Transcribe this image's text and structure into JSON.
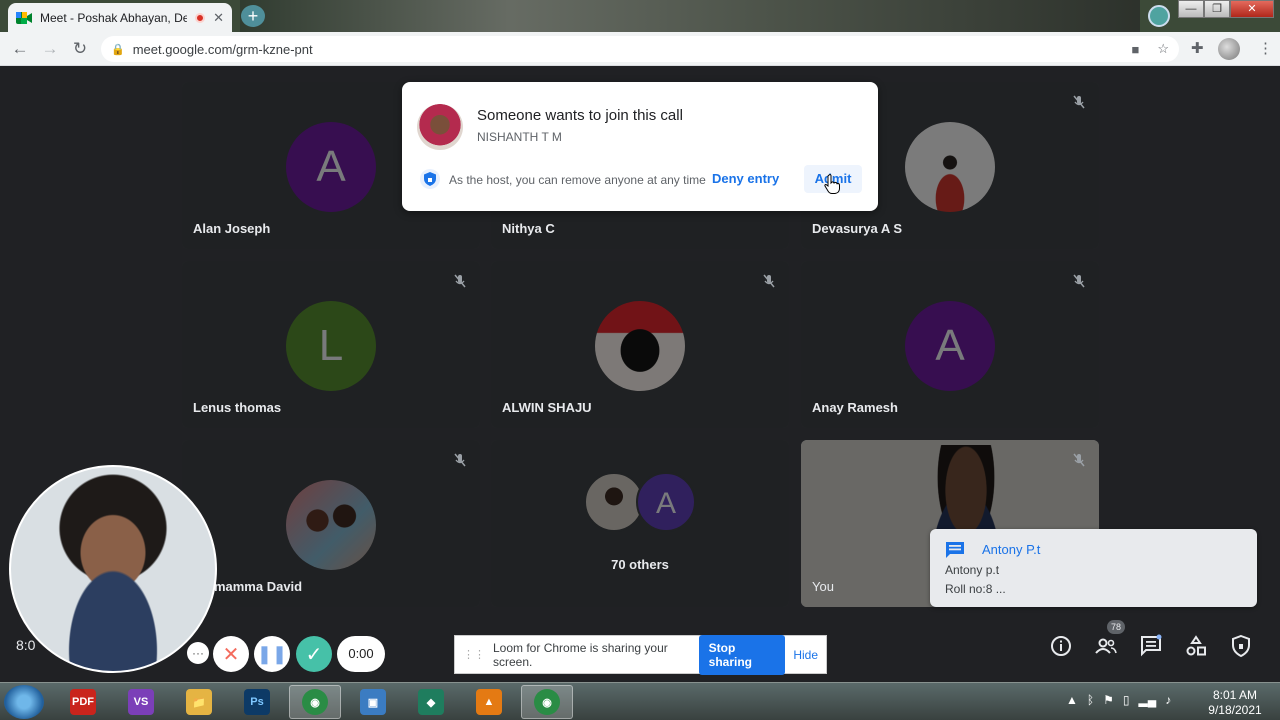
{
  "browser": {
    "tab_title": "Meet - Poshak Abhayan, De",
    "tab_close": "✕",
    "new_tab": "+",
    "url": "meet.google.com/grm-kzne-pnt",
    "window_controls": [
      "—",
      "❐",
      "✕"
    ]
  },
  "tiles": [
    {
      "name": "Alan Joseph",
      "avatar_letter": "A",
      "avatar_color": "#6a1b9a"
    },
    {
      "name": "Nithya C"
    },
    {
      "name": "Devasurya A S"
    },
    {
      "name": "Lenus thomas",
      "avatar_letter": "L",
      "avatar_color": "#558b2f"
    },
    {
      "name": "ALWIN SHAJU"
    },
    {
      "name": "Anay Ramesh",
      "avatar_letter": "A",
      "avatar_color": "#6a1b9a"
    },
    {
      "name": "Ammamma David"
    },
    {
      "others_label": "70 others",
      "avatar_letter": "A"
    },
    {
      "name": "You"
    }
  ],
  "join_request": {
    "title": "Someone wants to join this call",
    "name": "NISHANTH T M",
    "note": "As the host, you can remove anyone at any time",
    "deny_label": "Deny entry",
    "admit_label": "Admit"
  },
  "chat_toast": {
    "sender": "Antony P.t",
    "line1": "Antony p.t",
    "line2": "Roll no:8 ..."
  },
  "bottom_bar": {
    "time_partial": "8:0",
    "people_count": "78"
  },
  "loom": {
    "more": "···",
    "cancel": "✕",
    "pause": "❚❚",
    "done": "✓",
    "timer": "0:00",
    "share_text": "Loom for Chrome is sharing your screen.",
    "stop_label": "Stop sharing",
    "hide_label": "Hide"
  },
  "taskbar": {
    "apps": [
      {
        "label": "PDF",
        "color": "#c9241c"
      },
      {
        "label": "VS",
        "color": "#7b3fb8"
      },
      {
        "label": "📁",
        "color": "#e5b443"
      },
      {
        "label": "Ps",
        "color": "#0d3a66"
      },
      {
        "label": "◉",
        "color": "#2a8c45"
      },
      {
        "label": "▣",
        "color": "#3b7cc2"
      },
      {
        "label": "◆",
        "color": "#1f7d5e"
      },
      {
        "label": "▲",
        "color": "#e47a13"
      },
      {
        "label": "◉",
        "color": "#2a8c45"
      }
    ],
    "time": "8:01 AM",
    "date": "9/18/2021"
  }
}
